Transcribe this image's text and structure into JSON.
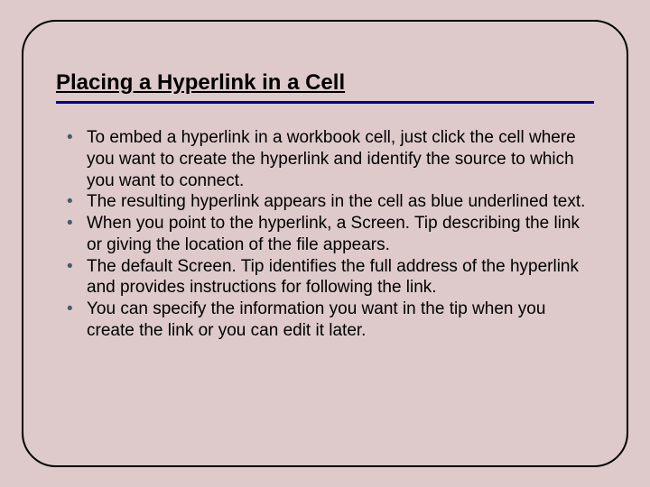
{
  "slide": {
    "title": "Placing a Hyperlink in a Cell",
    "bullets": [
      "To embed a hyperlink in a workbook cell, just click the cell where you want to create the hyperlink and identify the source to which you want to connect.",
      "The resulting hyperlink appears in the cell as blue underlined text.",
      "When you point to the hyperlink, a Screen. Tip describing the link or giving the location of the file appears.",
      "The default Screen. Tip identifies the full address of the hyperlink and provides instructions for following the link.",
      "You can specify the information you want in the tip when you create the link or you can edit it later."
    ]
  }
}
